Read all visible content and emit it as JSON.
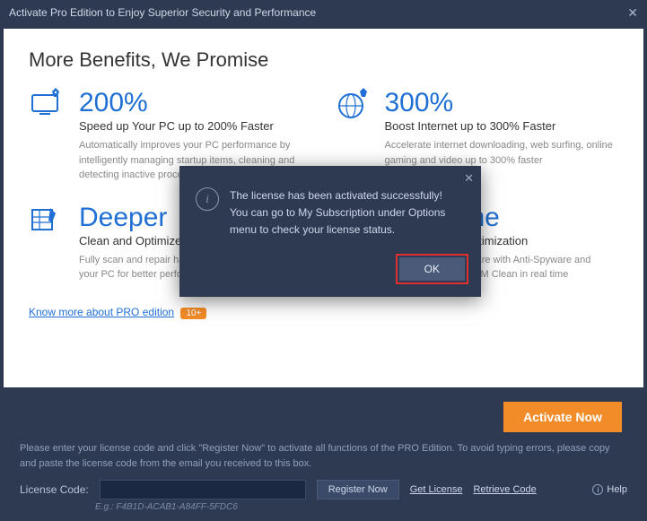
{
  "titlebar": {
    "title": "Activate Pro Edition to Enjoy Superior Security and Performance"
  },
  "headline": "More Benefits, We Promise",
  "features": [
    {
      "big": "200%",
      "sub": "Speed up Your PC up to 200% Faster",
      "desc": "Automatically improves your PC performance by intelligently managing startup items, cleaning and detecting inactive processes and optimizing as RAM"
    },
    {
      "big": "300%",
      "sub": "Boost Internet up to 300% Faster",
      "desc": "Accelerate internet downloading, web surfing, online gaming and video up to 300% faster"
    },
    {
      "big": "Deeper",
      "sub": "Clean and Optimize",
      "desc": "Fully scan and repair hard disk problems to keep your PC for better performance"
    },
    {
      "big": "Real-time",
      "sub": "Protection and Optimization",
      "desc": "Protect against malware with Anti-Spyware and optimize with Auto RAM Clean in real time"
    }
  ],
  "know": {
    "link": "Know more about PRO edition",
    "badge": "10+"
  },
  "footer": {
    "activate": "Activate Now",
    "note": "Please enter your license code and click \"Register Now\" to activate all functions of the PRO Edition. To avoid typing errors, please copy and paste the license code from the email you received to this box.",
    "lclabel": "License Code:",
    "lcvalue": "",
    "register": "Register Now",
    "getlicense": "Get License",
    "retrieve": "Retrieve Code",
    "help": "Help",
    "eg": "E.g.: F4B1D-ACAB1-A84FF-5FDC6"
  },
  "modal": {
    "line1": "The license has been activated successfully!",
    "line2": "You can go to My Subscription under Options menu to check your license status.",
    "ok": "OK"
  }
}
